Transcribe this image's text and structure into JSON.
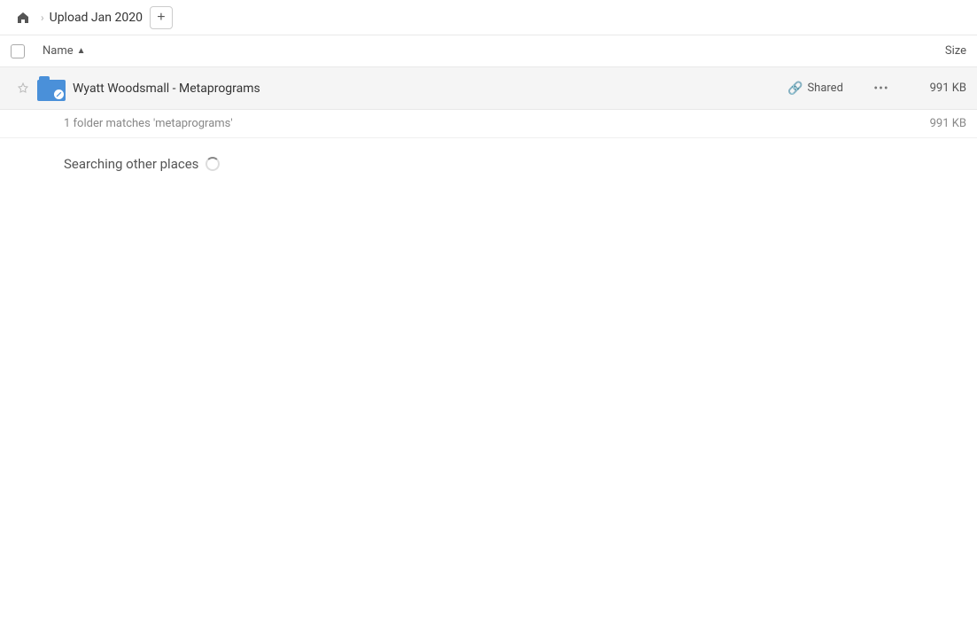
{
  "header": {
    "home_label": "Home",
    "breadcrumb_title": "Upload Jan 2020",
    "add_button_label": "+"
  },
  "table": {
    "col_name_label": "Name",
    "col_size_label": "Size",
    "sort_arrow": "▲"
  },
  "file_row": {
    "name": "Wyatt Woodsmall - Metaprograms",
    "shared_label": "Shared",
    "size": "991 KB",
    "more_icon": "•••"
  },
  "summary": {
    "text": "1 folder matches 'metaprograms'",
    "size": "991 KB"
  },
  "searching": {
    "text": "Searching other places"
  }
}
